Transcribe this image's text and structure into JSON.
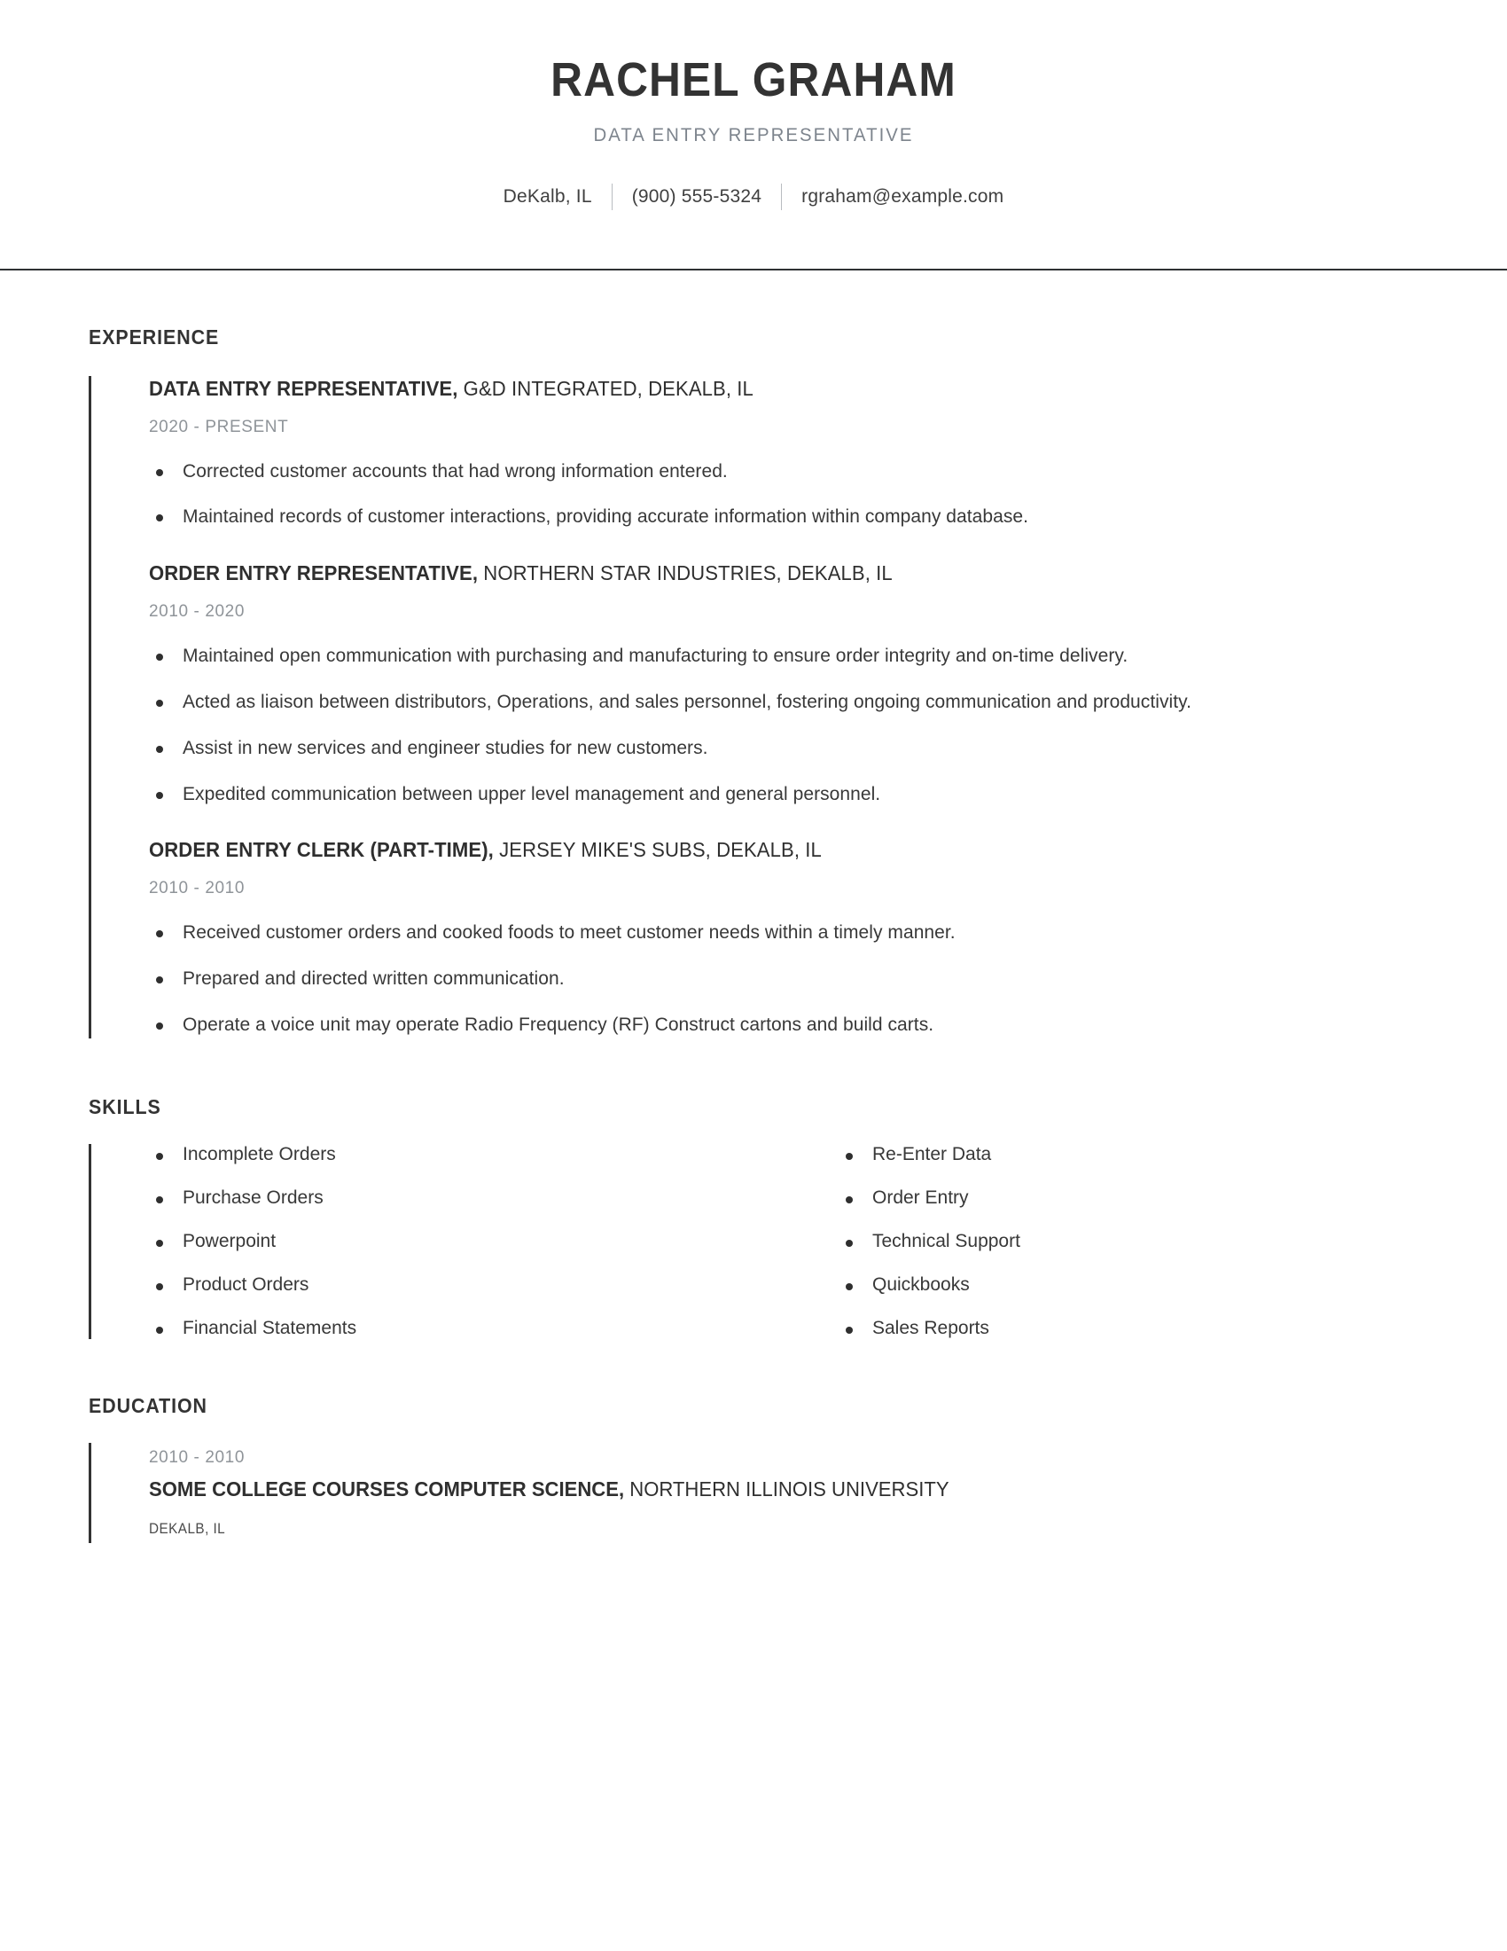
{
  "header": {
    "name": "RACHEL GRAHAM",
    "subtitle": "DATA ENTRY REPRESENTATIVE",
    "contact": {
      "location": "DeKalb, IL",
      "phone": "(900) 555-5324",
      "email": "rgraham@example.com"
    }
  },
  "sections": {
    "experience": {
      "title": "EXPERIENCE",
      "jobs": [
        {
          "title": "DATA ENTRY REPRESENTATIVE,",
          "company": " G&D INTEGRATED, DEKALB, IL",
          "dates": "2020 - PRESENT",
          "bullets": [
            "Corrected customer accounts that had wrong information entered.",
            "Maintained records of customer interactions, providing accurate information within company database."
          ]
        },
        {
          "title": "ORDER ENTRY REPRESENTATIVE,",
          "company": " NORTHERN STAR INDUSTRIES, DEKALB, IL",
          "dates": "2010 - 2020",
          "bullets": [
            "Maintained open communication with purchasing and manufacturing to ensure order integrity and on-time delivery.",
            "Acted as liaison between distributors, Operations, and sales personnel, fostering ongoing communication and productivity.",
            "Assist in new services and engineer studies for new customers.",
            "Expedited communication between upper level management and general personnel."
          ]
        },
        {
          "title": "ORDER ENTRY CLERK (PART-TIME),",
          "company": " JERSEY MIKE'S SUBS, DEKALB, IL",
          "dates": "2010 - 2010",
          "bullets": [
            "Received customer orders and cooked foods to meet customer needs within a timely manner.",
            "Prepared and directed written communication.",
            "Operate a voice unit may operate Radio Frequency (RF) Construct cartons and build carts."
          ]
        }
      ]
    },
    "skills": {
      "title": "SKILLS",
      "column_left": [
        "Incomplete Orders",
        "Purchase Orders",
        "Powerpoint",
        "Product Orders",
        "Financial Statements"
      ],
      "column_right": [
        "Re-Enter Data",
        "Order Entry",
        "Technical Support",
        "Quickbooks",
        "Sales Reports"
      ]
    },
    "education": {
      "title": "EDUCATION",
      "entries": [
        {
          "dates": "2010 - 2010",
          "degree": "SOME COLLEGE COURSES COMPUTER SCIENCE,",
          "school": " NORTHERN ILLINOIS UNIVERSITY",
          "location": "DEKALB, IL"
        }
      ]
    }
  },
  "colors": {
    "text_primary": "#333333",
    "text_muted": "#8f9499",
    "subtitle": "#7d848d",
    "rule": "#2f3133",
    "accent_bar": "#333333"
  }
}
